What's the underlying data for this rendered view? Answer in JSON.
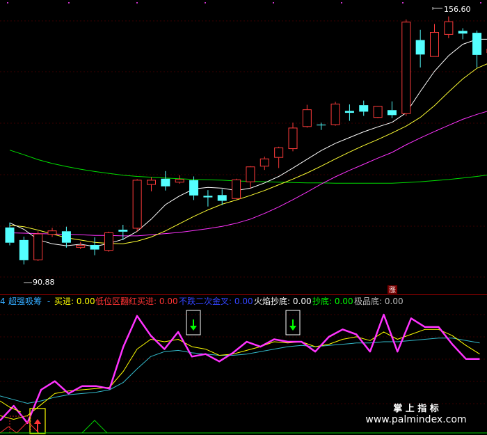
{
  "colors": {
    "background": "#000000",
    "up": "#ff3b3b",
    "down": "#54ffff",
    "ma5": "#ffffff",
    "ma10": "#ffff33",
    "ma30": "#ff33ff",
    "ma60": "#00dd00",
    "grid": "#3a0000",
    "panel_border": "#9a0000",
    "magenta_line": "#ff33ff",
    "yellow_line": "#ffff00",
    "teal_line": "#33bbcc"
  },
  "price_labels": {
    "high": "156.60",
    "low": "90.88"
  },
  "limit_up_badge": "涨",
  "indicator_header": {
    "period": "4",
    "name": "超强吸筹",
    "dash": "-",
    "items": [
      {
        "label": "买进:",
        "value": "0.00",
        "color": "#ffff00"
      },
      {
        "label": "低位区翻红买进:",
        "value": "0.00",
        "color": "#ff3333"
      },
      {
        "label": "不跌二次金叉:",
        "value": "0.00",
        "color": "#3344ff"
      },
      {
        "label": "火焰抄底:",
        "value": "0.00",
        "color": "#ffffff"
      },
      {
        "label": "抄底:",
        "value": "0.00",
        "color": "#00ff00"
      },
      {
        "label": "极品底:",
        "value": "0.00",
        "color": "#bbbbbb"
      }
    ]
  },
  "watermark": {
    "line1": "掌 上 指 标",
    "line2": "www.palmindex.com"
  },
  "chart_data": [
    {
      "type": "candlestick",
      "y_range": [
        86,
        160
      ],
      "candles": [
        {
          "o": 101.2,
          "h": 102.5,
          "c": 97.2,
          "l": 96.5
        },
        {
          "o": 97.9,
          "h": 98.8,
          "c": 92.6,
          "l": 91.5
        },
        {
          "o": 92.6,
          "h": 100.2,
          "c": 99.6,
          "l": 92.4
        },
        {
          "o": 99.3,
          "h": 101.1,
          "c": 100.4,
          "l": 98.7
        },
        {
          "o": 100.2,
          "h": 101.4,
          "c": 97.2,
          "l": 95.9
        },
        {
          "o": 95.9,
          "h": 97.4,
          "c": 96.6,
          "l": 95.5
        },
        {
          "o": 96.6,
          "h": 98.6,
          "c": 95.4,
          "l": 93.9
        },
        {
          "o": 95.1,
          "h": 100.1,
          "c": 99.9,
          "l": 94.8
        },
        {
          "o": 100.6,
          "h": 101.9,
          "c": 100.1,
          "l": 97.9
        },
        {
          "o": 100.9,
          "h": 113.9,
          "c": 113.7,
          "l": 100.1
        },
        {
          "o": 112.4,
          "h": 114.4,
          "c": 113.7,
          "l": 110.7
        },
        {
          "o": 114.0,
          "h": 116.0,
          "c": 112.0,
          "l": 110.9
        },
        {
          "o": 113.0,
          "h": 114.9,
          "c": 113.9,
          "l": 112.7
        },
        {
          "o": 113.6,
          "h": 114.6,
          "c": 109.6,
          "l": 108.4
        },
        {
          "o": 109.5,
          "h": 111.0,
          "c": 109.1,
          "l": 106.7
        },
        {
          "o": 109.7,
          "h": 111.2,
          "c": 108.2,
          "l": 107.1
        },
        {
          "o": 108.7,
          "h": 114.0,
          "c": 113.8,
          "l": 108.6
        },
        {
          "o": 113.1,
          "h": 117.3,
          "c": 117.2,
          "l": 111.5
        },
        {
          "o": 117.2,
          "h": 119.8,
          "c": 119.3,
          "l": 116.3
        },
        {
          "o": 119.5,
          "h": 122.4,
          "c": 122.2,
          "l": 116.8
        },
        {
          "o": 121.8,
          "h": 128.7,
          "c": 127.4,
          "l": 121.2
        },
        {
          "o": 127.6,
          "h": 133.4,
          "c": 132.2,
          "l": 127.4
        },
        {
          "o": 128.2,
          "h": 128.7,
          "c": 128.0,
          "l": 126.8
        },
        {
          "o": 128.1,
          "h": 134.2,
          "c": 133.7,
          "l": 127.9
        },
        {
          "o": 131.8,
          "h": 133.5,
          "c": 131.3,
          "l": 129.2
        },
        {
          "o": 133.3,
          "h": 134.5,
          "c": 131.6,
          "l": 130.5
        },
        {
          "o": 130.0,
          "h": 133.0,
          "c": 133.1,
          "l": 129.9
        },
        {
          "o": 132.0,
          "h": 134.3,
          "c": 130.7,
          "l": 129.9
        },
        {
          "o": 131.0,
          "h": 155.8,
          "c": 155.2,
          "l": 130.5
        },
        {
          "o": 150.4,
          "h": 153.1,
          "c": 146.6,
          "l": 143.2
        },
        {
          "o": 146.0,
          "h": 154.6,
          "c": 152.5,
          "l": 146.0
        },
        {
          "o": 151.8,
          "h": 156.6,
          "c": 155.3,
          "l": 150.9
        },
        {
          "o": 152.8,
          "h": 153.5,
          "c": 152.1,
          "l": 150.6
        },
        {
          "o": 152.3,
          "h": 152.9,
          "c": 146.5,
          "l": 143.2
        },
        {
          "o": 147.0,
          "h": 149.0,
          "c": 148.1,
          "l": 146.6
        }
      ],
      "moving_averages": [
        {
          "name": "MA5",
          "color": "#ffffff",
          "values": [
            102.4,
            100.7,
            98.0,
            96.9,
            96.4,
            96.8,
            96.2,
            97.0,
            98.1,
            100.2,
            103.4,
            107.2,
            109.5,
            111.3,
            111.7,
            111.5,
            110.9,
            111.5,
            112.9,
            114.6,
            116.8,
            119.1,
            121.4,
            123.3,
            124.8,
            126.3,
            127.6,
            128.8,
            131.3,
            136.9,
            142.2,
            146.3,
            149.3,
            150.6,
            150.6
          ]
        },
        {
          "name": "MA10",
          "color": "#ffff33",
          "values": [
            101.8,
            101.4,
            100.5,
            99.5,
            98.5,
            97.9,
            97.3,
            97.0,
            96.9,
            97.6,
            98.7,
            100.3,
            102.2,
            104.1,
            105.8,
            107.3,
            108.4,
            109.6,
            110.9,
            112.4,
            113.9,
            115.5,
            117.3,
            119.2,
            121.0,
            122.7,
            124.3,
            126.0,
            127.8,
            130.1,
            133.2,
            136.8,
            140.2,
            143.0,
            144.6
          ]
        },
        {
          "name": "MA30",
          "color": "#ff33ff",
          "values": [
            99.8,
            99.7,
            99.6,
            99.5,
            99.4,
            99.3,
            99.1,
            99.1,
            99.0,
            99.0,
            99.3,
            99.6,
            99.9,
            100.4,
            100.9,
            101.5,
            102.3,
            103.4,
            104.9,
            106.6,
            108.5,
            110.5,
            112.6,
            114.5,
            116.2,
            117.8,
            119.4,
            120.9,
            122.9,
            124.7,
            126.4,
            128.0,
            129.6,
            130.9,
            132.0
          ]
        },
        {
          "name": "MA60",
          "color": "#00dd00",
          "values": [
            121.5,
            120.3,
            119.0,
            118.0,
            117.2,
            116.5,
            115.9,
            115.4,
            114.9,
            114.6,
            114.4,
            114.2,
            114.0,
            113.8,
            113.7,
            113.6,
            113.4,
            113.3,
            113.2,
            113.1,
            113.0,
            112.9,
            112.9,
            112.8,
            112.8,
            112.8,
            112.8,
            112.8,
            113.0,
            113.2,
            113.5,
            113.8,
            114.2,
            114.6,
            115.1
          ]
        }
      ]
    },
    {
      "type": "line",
      "y_range": [
        0,
        100
      ],
      "series": [
        {
          "color": "#ff33ff",
          "values": [
            10,
            22,
            8,
            35,
            42,
            32,
            38,
            38,
            36,
            70,
            95,
            79,
            68,
            82,
            62,
            64,
            58,
            65,
            74,
            70,
            76,
            74,
            74,
            66,
            78,
            84,
            80,
            66,
            96,
            66,
            93,
            86,
            86,
            72,
            60,
            60
          ]
        },
        {
          "color": "#ffff00",
          "values": [
            14,
            11,
            14,
            23,
            32,
            34,
            35,
            36,
            37,
            50,
            68,
            76,
            74,
            76,
            70,
            68,
            63,
            64,
            67,
            70,
            74,
            73,
            74,
            70,
            72,
            76,
            78,
            75,
            82,
            76,
            80,
            84,
            84,
            79,
            71,
            64
          ]
        },
        {
          "color": "#33bbcc",
          "values": [
            30,
            27,
            24,
            26,
            29,
            31,
            32,
            33,
            35,
            41,
            52,
            62,
            66,
            67,
            65,
            64,
            63,
            63,
            64,
            66,
            68,
            70,
            71,
            70,
            71,
            72,
            73,
            73,
            74,
            74,
            75,
            76,
            77,
            77,
            75,
            73
          ]
        }
      ]
    }
  ]
}
